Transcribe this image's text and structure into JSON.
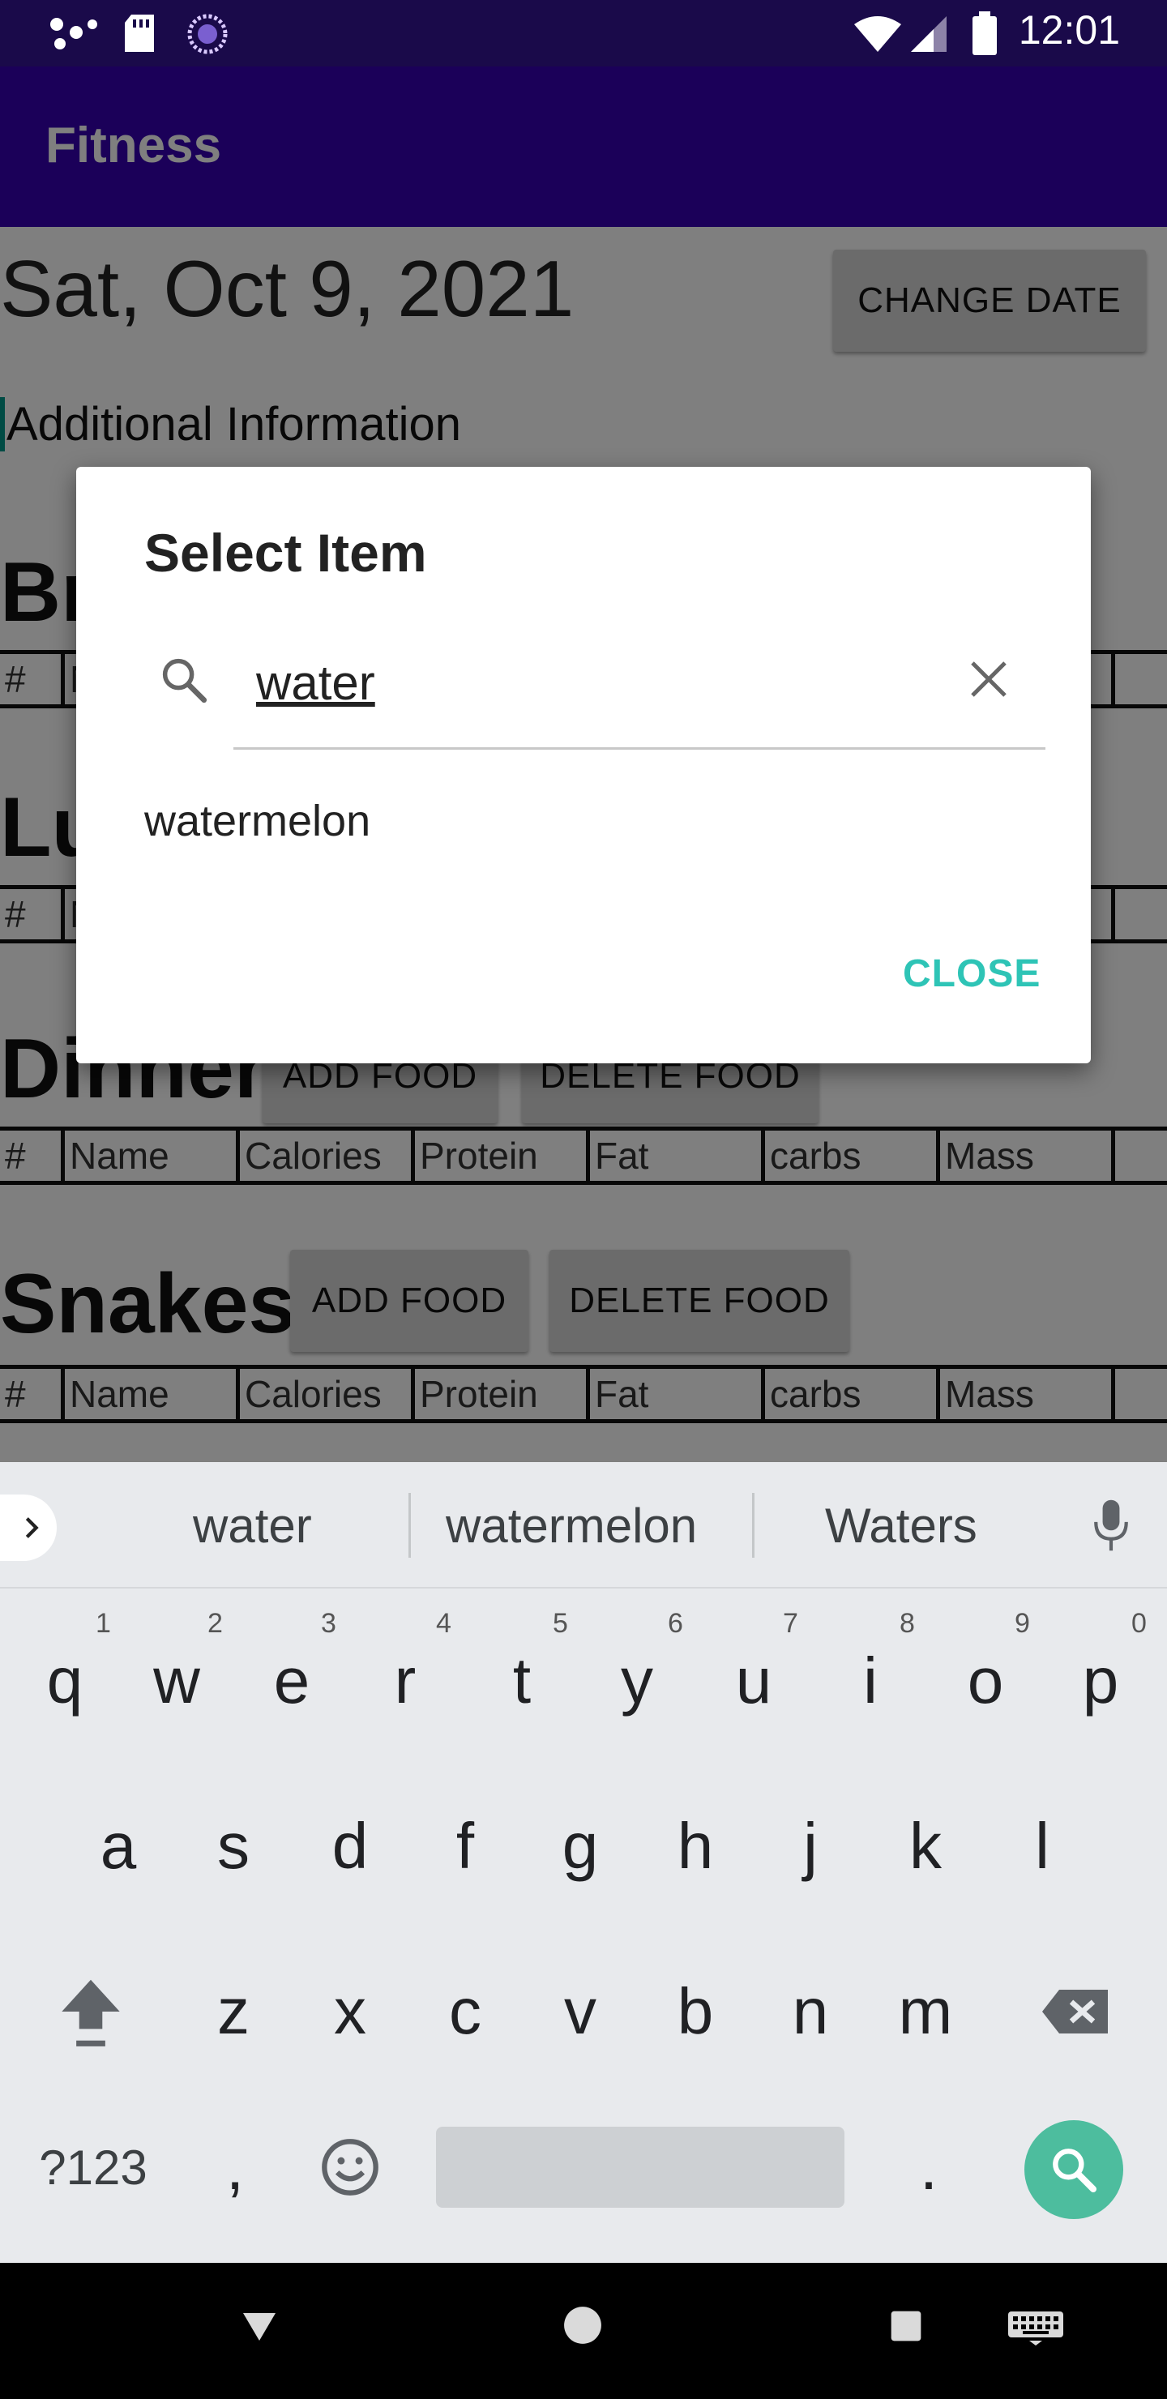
{
  "status_bar": {
    "time": "12:01"
  },
  "app_bar": {
    "title": "Fitness"
  },
  "content": {
    "date": "Sat, Oct 9, 2021",
    "change_date_label": "CHANGE DATE",
    "additional_info": "Additional Information",
    "meals": [
      {
        "title": "Breakfast"
      },
      {
        "title": "Lunch"
      },
      {
        "title": "Dinner",
        "add_label": "ADD FOOD",
        "delete_label": "DELETE FOOD"
      },
      {
        "title": "Snakes",
        "add_label": "ADD FOOD",
        "delete_label": "DELETE FOOD"
      }
    ],
    "columns": [
      "#",
      "Name",
      "Calories",
      "Protein",
      "Fat",
      "carbs",
      "Mass"
    ]
  },
  "dialog": {
    "title": "Select Item",
    "query": "water",
    "results": [
      "watermelon"
    ],
    "close_label": "CLOSE"
  },
  "keyboard": {
    "suggestions": [
      "water",
      "watermelon",
      "Waters"
    ],
    "row1": [
      "q",
      "w",
      "e",
      "r",
      "t",
      "y",
      "u",
      "i",
      "o",
      "p"
    ],
    "row1_hints": [
      "1",
      "2",
      "3",
      "4",
      "5",
      "6",
      "7",
      "8",
      "9",
      "0"
    ],
    "row2": [
      "a",
      "s",
      "d",
      "f",
      "g",
      "h",
      "j",
      "k",
      "l"
    ],
    "row3": [
      "z",
      "x",
      "c",
      "v",
      "b",
      "n",
      "m"
    ],
    "symbols_label": "?123",
    "comma": ",",
    "period": "."
  }
}
